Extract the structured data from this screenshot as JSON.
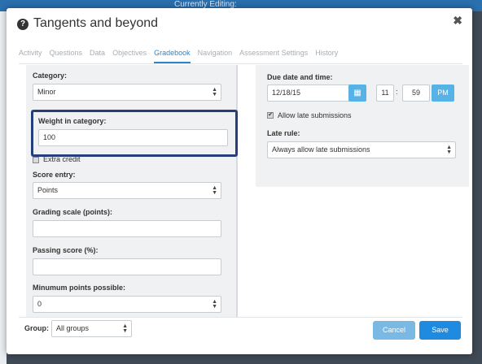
{
  "background": {
    "currently_editing": "Currently Editing:"
  },
  "modal": {
    "title": "Tangents and beyond",
    "close_glyph": "✖"
  },
  "tabs": [
    {
      "label": "Activity"
    },
    {
      "label": "Questions"
    },
    {
      "label": "Data"
    },
    {
      "label": "Objectives"
    },
    {
      "label": "Gradebook"
    },
    {
      "label": "Navigation"
    },
    {
      "label": "Assessment Settings"
    },
    {
      "label": "History"
    }
  ],
  "left": {
    "category_label": "Category:",
    "category_value": "Minor",
    "weight_label": "Weight in category:",
    "weight_value": "100",
    "extra_credit_label": "Extra credit",
    "score_entry_label": "Score entry:",
    "score_entry_value": "Points",
    "grading_scale_label": "Grading scale (points):",
    "grading_scale_value": "",
    "passing_score_label": "Passing score (%):",
    "passing_score_value": "",
    "min_points_label": "Minumum points possible:",
    "min_points_value": "0"
  },
  "right": {
    "due_label": "Due date and time:",
    "due_date": "12/18/15",
    "hour": "11",
    "colon": ":",
    "minute": "59",
    "ampm": "PM",
    "allow_late_label": "Allow late submissions",
    "allow_late_checked": true,
    "late_rule_label": "Late rule:",
    "late_rule_value": "Always allow late submissions"
  },
  "footer": {
    "group_label": "Group:",
    "group_value": "All groups",
    "cancel_label": "Cancel",
    "save_label": "Save"
  },
  "colors": {
    "accent": "#2e86c7",
    "primary_button": "#1f8be0",
    "cancel_button": "#7ab9e3",
    "highlight_border": "#263f7a"
  }
}
